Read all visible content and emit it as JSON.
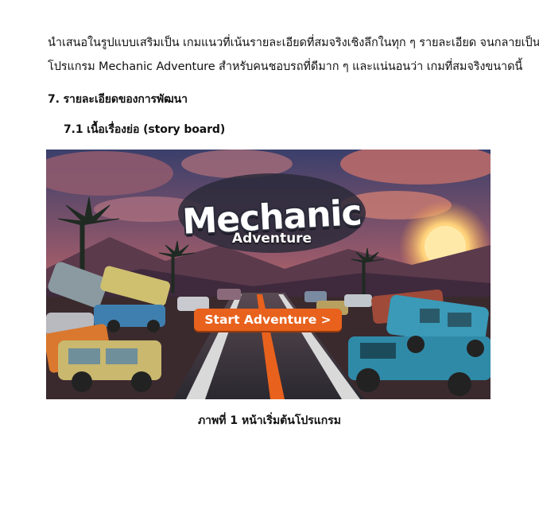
{
  "document": {
    "paragraph_line_1": "นำเสนอในรูปแบบเสริมเป็น เกมแนวที่เน้นรายละเอียดที่สมจริงเชิงลึกในทุก ๆ รายละเอียด จนกลายเป็น",
    "paragraph_line_2": "โปรแกรม Mechanic Adventure สำหรับคนชอบรถที่ดีมาก ๆ และแน่นอนว่า เกมที่สมจริงขนาดนี้",
    "section_heading": "7. รายละเอียดของการพัฒนา",
    "subsection_heading": "7.1 เนื้อเรื่องย่อ (story board)",
    "figure_caption": "ภาพที่ 1 หน้าเริ่มต้นโปรแกรม"
  },
  "game_screen": {
    "title": "Mechanic",
    "subtitle": "Adventure",
    "start_button": "Start Adventure >",
    "colors": {
      "button": "#e8621d",
      "sky_top": "#3a3f6b",
      "sky_horizon": "#f0965a",
      "sun": "#ffe9a8"
    }
  }
}
